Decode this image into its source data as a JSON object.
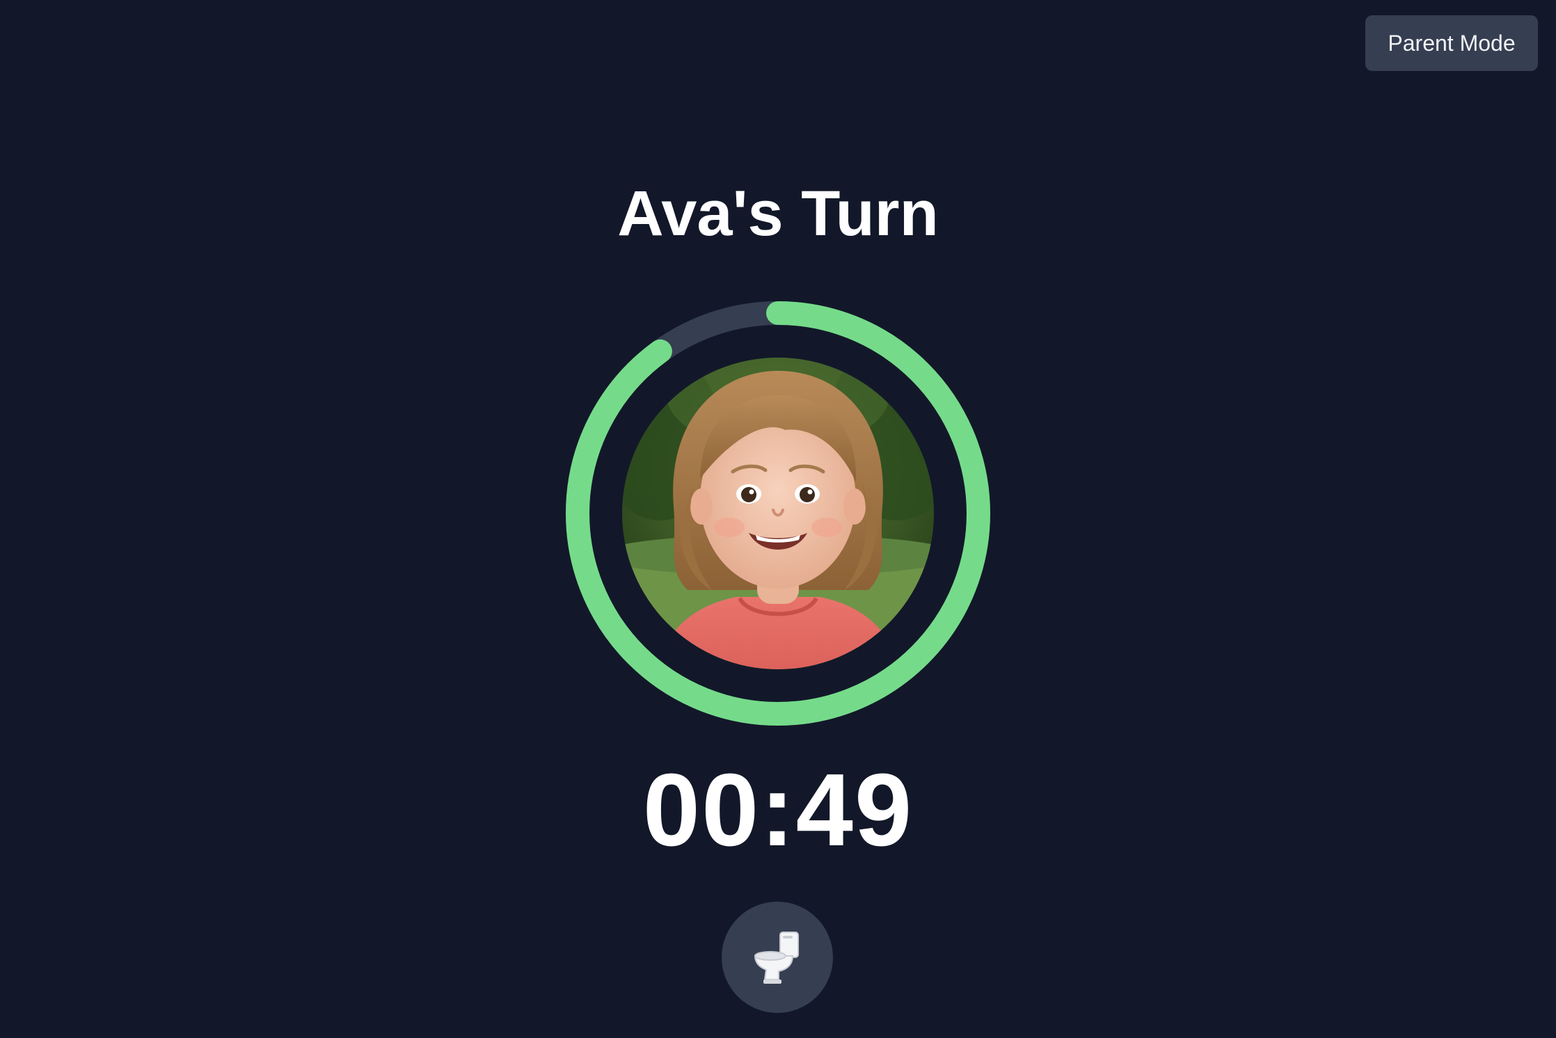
{
  "header": {
    "parent_mode_label": "Parent Mode"
  },
  "turn": {
    "title": "Ava's Turn",
    "child_name": "Ava"
  },
  "timer": {
    "display": "00:49",
    "remaining_fraction": 0.9,
    "track_color": "#363e51",
    "progress_color": "#75db8a"
  },
  "actions": {
    "potty_icon": "toilet-icon"
  },
  "colors": {
    "background": "#121829",
    "button": "#363e51",
    "text": "#ffffff"
  }
}
